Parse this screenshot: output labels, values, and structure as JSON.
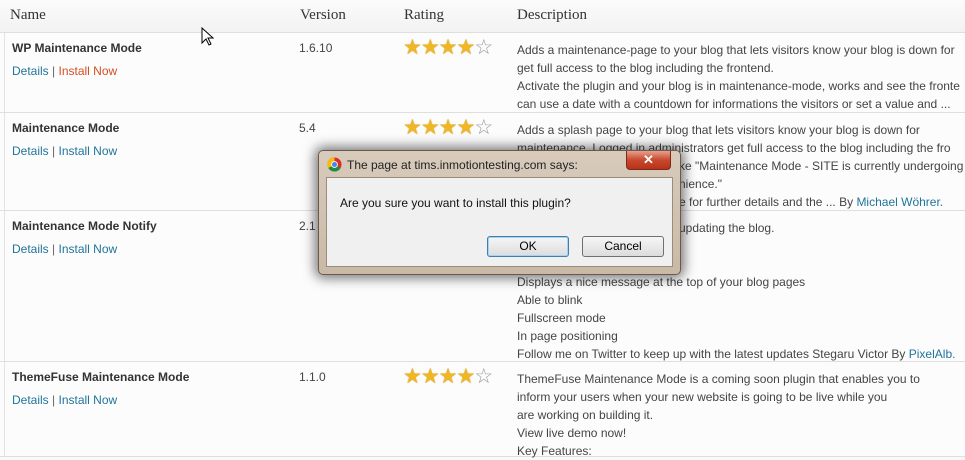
{
  "table": {
    "headers": {
      "name": "Name",
      "version": "Version",
      "rating": "Rating",
      "description": "Description"
    },
    "rows": [
      {
        "name": "WP Maintenance Mode",
        "details": "Details",
        "install": "Install Now",
        "version": "1.6.10",
        "rating": 4,
        "rating_max": 5,
        "desc_lines": [
          "Adds a maintenance-page to your blog that lets visitors know your blog is down for",
          "get full access to the blog including the frontend.",
          "Activate the plugin and your blog is in maintenance-mode, works and see the fronte",
          "can use a date with a countdown for informations the visitors or set a value and ..."
        ]
      },
      {
        "name": "Maintenance Mode",
        "details": "Details",
        "install": "Install Now",
        "version": "5.4",
        "rating": 4,
        "rating_max": 5,
        "desc_lines": [
          "Adds a splash page to your blog that lets visitors know your blog is down for",
          "maintenance. Logged in administrators get full access to the blog including the fro",
          "ke \"Maintenance Mode - SITE is currently undergoing",
          "nience.\"",
          "e for further details and the ... By "
        ],
        "author": "Michael Wöhrer."
      },
      {
        "name": "Maintenance Mode Notify",
        "details": "Details",
        "install": "Install Now",
        "version": "2.1",
        "desc_lines": [
          "updating the blog.",
          "Displays a nice message at the top of your blog pages",
          "Able to blink",
          "Fullscreen mode",
          "In page positioning",
          "Follow me on Twitter to keep up with the latest updates Stegaru Victor By "
        ],
        "author": "PixelAlb."
      },
      {
        "name": "ThemeFuse Maintenance Mode",
        "details": "Details",
        "install": "Install Now",
        "version": "1.1.0",
        "rating": 4,
        "rating_max": 5,
        "desc_lines": [
          "ThemeFuse Maintenance Mode is a coming soon plugin that enables you to",
          "inform your users when your new website is going to be live while you",
          "are working on building it.",
          "View live demo now!",
          "Key Features:"
        ]
      }
    ]
  },
  "dialog": {
    "title": "The page at tims.inmotiontesting.com says:",
    "close_glyph": "✕",
    "message": "Are you sure you want to install this plugin?",
    "ok_label": "OK",
    "cancel_label": "Cancel"
  },
  "colors": {
    "link": "#21759b",
    "hot_link": "#d54e21",
    "star": "#f0b623"
  }
}
